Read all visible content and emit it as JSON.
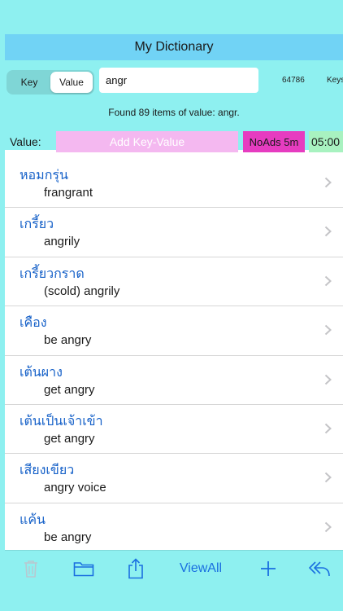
{
  "app": {
    "title": "My Dictionary"
  },
  "search": {
    "segments": [
      {
        "label": "Key",
        "active": false
      },
      {
        "label": "Value",
        "active": true
      }
    ],
    "query": "angr",
    "count": "64786",
    "keys_label": "Keys",
    "found_text": "Found 89 items of value: angr."
  },
  "action_bar": {
    "value_label": "Value:",
    "add_placeholder": "Add Key-Value",
    "noads_label": "NoAds 5m",
    "timer": "05:00"
  },
  "entries": [
    {
      "key": "หอมกรุ่น",
      "value": "frangrant"
    },
    {
      "key": "เกรี้ยว",
      "value": "angrily"
    },
    {
      "key": "เกรี้ยวกราด",
      "value": "(scold) angrily"
    },
    {
      "key": "เคือง",
      "value": "be angry"
    },
    {
      "key": "เต้นผาง",
      "value": "get angry"
    },
    {
      "key": "เต้นเป็นเจ้าเข้า",
      "value": "get angry"
    },
    {
      "key": "เสียงเขียว",
      "value": "angry voice"
    },
    {
      "key": "แค้น",
      "value": "be angry"
    }
  ],
  "toolbar": {
    "viewall_label": "ViewAll",
    "icons": [
      "trash-icon",
      "folder-icon",
      "share-icon",
      "plus-icon",
      "reply-all-icon"
    ]
  },
  "colors": {
    "accent": "#1a6fe0",
    "title_bar": "#71d3f5",
    "panel": "#8ef0f0",
    "add_button": "#f4b8f0",
    "noads_button": "#e63cc0",
    "timer_bg": "#a8f2c0",
    "entry_key": "#1560c8"
  }
}
